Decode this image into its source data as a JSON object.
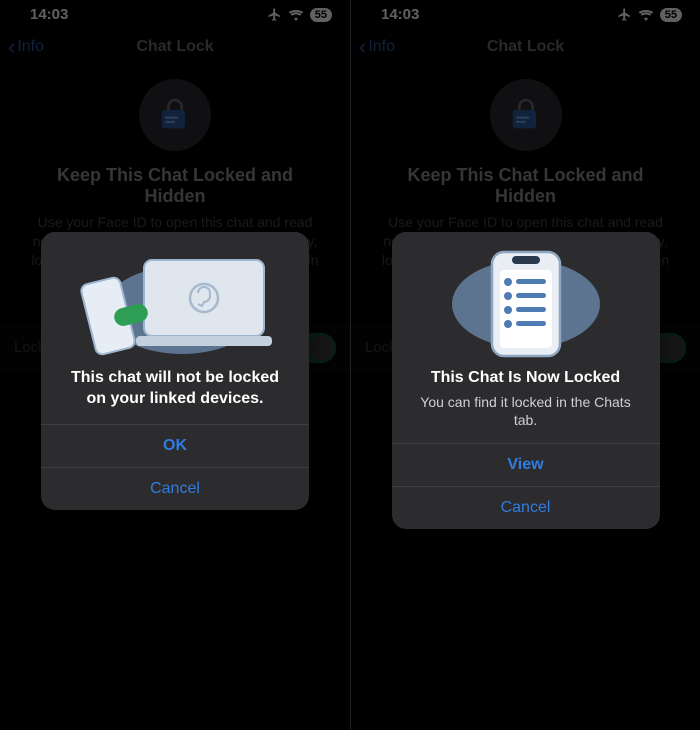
{
  "left": {
    "status": {
      "time": "14:03",
      "battery": "55"
    },
    "nav": {
      "back": "Info",
      "title": "Chat Lock"
    },
    "headline": "Keep This Chat Locked and Hidden",
    "subtext": "Use your Face ID to open this chat and read notifications on this phone. For added privacy, locked chats are moved to a separate folder in chats. Learn more",
    "toggle_label": "Lock This Chat",
    "modal": {
      "title": "This chat will not be locked on your linked devices.",
      "primary": "OK",
      "secondary": "Cancel"
    }
  },
  "right": {
    "status": {
      "time": "14:03",
      "battery": "55"
    },
    "nav": {
      "back": "Info",
      "title": "Chat Lock"
    },
    "headline": "Keep This Chat Locked and Hidden",
    "subtext": "Use your Face ID to open this chat and read notifications on this phone. For added privacy, locked chats are moved to a separate folder in chats. Learn more",
    "toggle_label": "Lock This Chat",
    "modal": {
      "title": "This Chat Is Now Locked",
      "desc": "You can find it locked in the Chats tab.",
      "primary": "View",
      "secondary": "Cancel"
    }
  }
}
